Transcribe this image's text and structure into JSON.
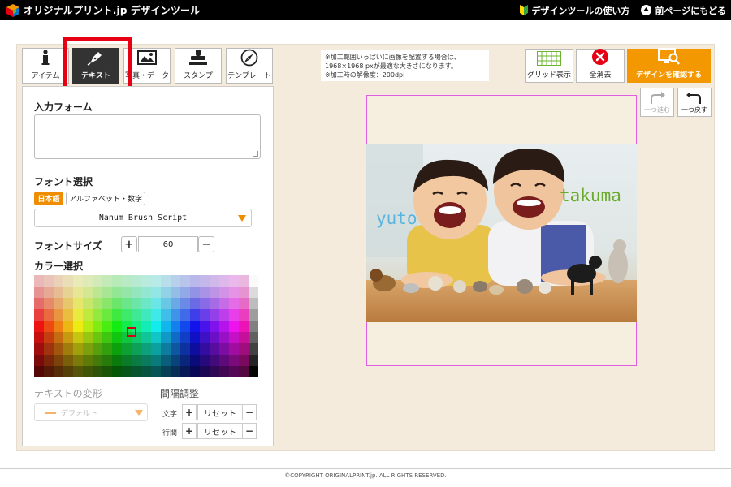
{
  "header": {
    "logo_text": "オリジナルプリント.jp デザインツール",
    "guide_link": "デザインツールの使い方",
    "back_link": "前ページにもどる"
  },
  "tabs": [
    {
      "label": "アイテム",
      "icon": "info-icon"
    },
    {
      "label": "テキスト",
      "icon": "pen-icon",
      "active": true
    },
    {
      "label": "写真・データ",
      "icon": "image-icon"
    },
    {
      "label": "スタンプ",
      "icon": "stamp-icon"
    },
    {
      "label": "テンプレート",
      "icon": "compass-icon"
    }
  ],
  "panel": {
    "input_label": "入力フォーム",
    "input_value": "",
    "font_label": "フォント選択",
    "font_tabs": {
      "japanese": "日本語",
      "alpha": "アルファベット・数字"
    },
    "font_selected": "Nanum Brush Script",
    "size_label": "フォントサイズ",
    "size_value": "60",
    "plus": "+",
    "minus": "−",
    "color_label": "カラー選択",
    "transform_label": "テキストの変形",
    "transform_value": "デフォルト",
    "spacing_label": "間隔調整",
    "char_label": "文字",
    "line_label": "行間",
    "reset": "リセット"
  },
  "notice": {
    "line1": "※加工範囲いっぱいに画像を配置する場合は、",
    "line2": "1968×1968 pxが最適な大きさになります。",
    "line3": "※加工時の解像度：200dpi"
  },
  "toolbar": {
    "grid": "グリッド表示",
    "clear": "全消去",
    "confirm": "デザインを確認する",
    "redo": "一つ進む",
    "undo": "一つ戻す"
  },
  "canvas": {
    "text1": "yuto",
    "text2": "takuma"
  },
  "footer": "©COPYRIGHT ORIGINALPRINT.jp. ALL RIGHTS RESERVED.",
  "colors": {
    "accent": "#f39800",
    "highlight": "#e60012",
    "text_yuto": "#5ab4e0",
    "text_takuma": "#6aaa2a"
  }
}
